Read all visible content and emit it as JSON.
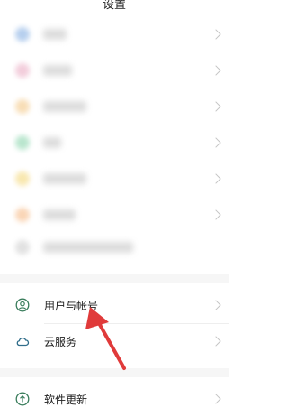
{
  "header": {
    "title": "设置"
  },
  "menu": {
    "items": [
      {
        "label": "用户与帐号",
        "icon": "account-icon"
      },
      {
        "label": "云服务",
        "icon": "cloud-icon"
      },
      {
        "label": "软件更新",
        "icon": "update-icon"
      }
    ]
  },
  "colors": {
    "accent": "#3a7d5c",
    "arrow": "#e03a3a"
  }
}
